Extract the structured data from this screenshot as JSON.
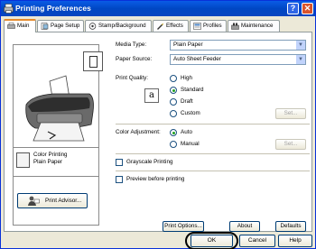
{
  "window": {
    "title": "Printing Preferences",
    "help_glyph": "?",
    "close_glyph": "✕"
  },
  "tabs": [
    {
      "label": "Main",
      "icon": "main-tab-icon"
    },
    {
      "label": "Page Setup",
      "icon": "page-setup-icon"
    },
    {
      "label": "Stamp/Background",
      "icon": "stamp-icon"
    },
    {
      "label": "Effects",
      "icon": "effects-icon"
    },
    {
      "label": "Profiles",
      "icon": "profiles-icon"
    },
    {
      "label": "Maintenance",
      "icon": "maintenance-icon"
    }
  ],
  "main": {
    "media_type_label": "Media Type:",
    "media_type_value": "Plain Paper",
    "paper_source_label": "Paper Source:",
    "paper_source_value": "Auto Sheet Feeder",
    "print_quality_label": "Print Quality:",
    "quality_options": [
      {
        "label": "High",
        "selected": false
      },
      {
        "label": "Standard",
        "selected": true
      },
      {
        "label": "Draft",
        "selected": false
      },
      {
        "label": "Custom",
        "selected": false
      }
    ],
    "quality_icon_glyph": "a",
    "set_label": "Set...",
    "color_adjustment_label": "Color Adjustment:",
    "color_options": [
      {
        "label": "Auto",
        "selected": true
      },
      {
        "label": "Manual",
        "selected": false
      }
    ],
    "grayscale_label": "Grayscale Printing",
    "grayscale_checked": false,
    "preview_label": "Preview before printing",
    "preview_checked": false,
    "media_info_line1": "Color Printing",
    "media_info_line2": "Plain Paper",
    "print_advisor_label": "Print Advisor...",
    "print_options_label": "Print Options...",
    "about_label": "About",
    "defaults_label": "Defaults"
  },
  "dialog_buttons": {
    "ok": "OK",
    "cancel": "Cancel",
    "help": "Help"
  },
  "colors": {
    "titlebar": "#0a5ce6",
    "active_tab_accent": "#e68b2c",
    "radio_dot": "#21a121"
  }
}
